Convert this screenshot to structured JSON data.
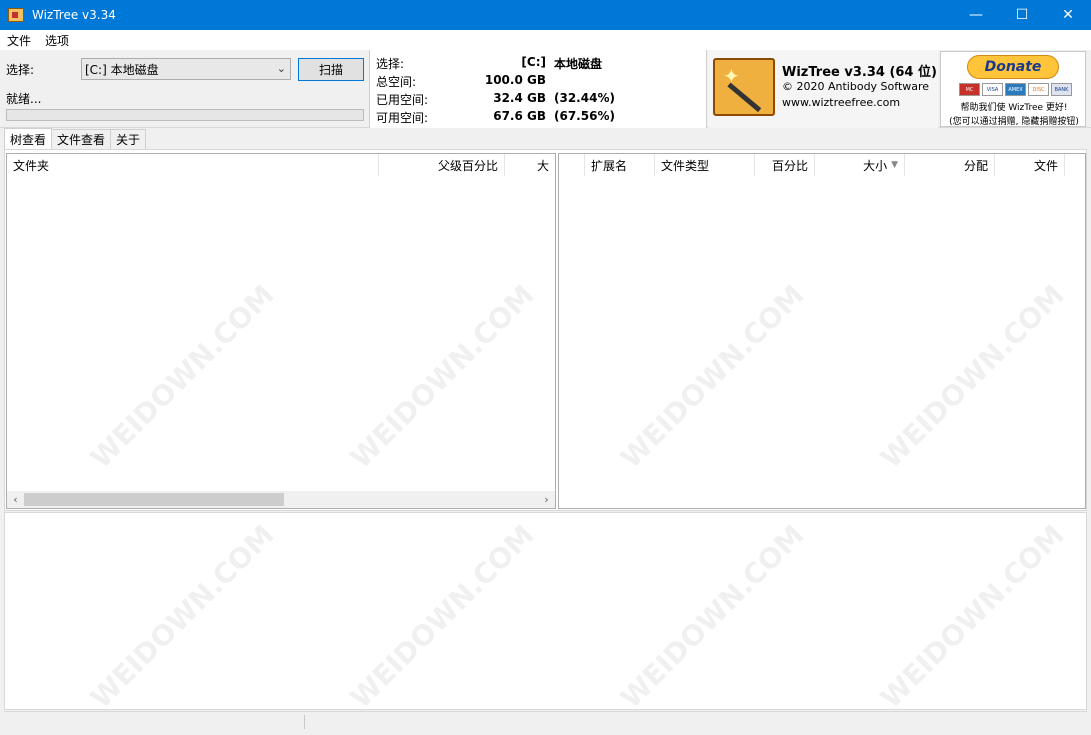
{
  "window": {
    "title": "WizTree v3.34",
    "controls": {
      "minimize": "—",
      "maximize": "☐",
      "close": "✕"
    }
  },
  "menu": [
    "文件",
    "选项"
  ],
  "scan": {
    "select_label": "选择:",
    "drive_value": "[C:] 本地磁盘",
    "scan_button": "扫描",
    "status": "就绪..."
  },
  "info": {
    "select_label": "选择:",
    "select_drive": "[C:]",
    "select_name": "本地磁盘",
    "total_label": "总空间:",
    "total_value": "100.0 GB",
    "used_label": "已用空间:",
    "used_value": "32.4 GB",
    "used_pct": "(32.44%)",
    "free_label": "可用空间:",
    "free_value": "67.6 GB",
    "free_pct": "(67.56%)"
  },
  "brand": {
    "name": "WizTree v3.34 (64 位)",
    "copyright": "© 2020 Antibody Software",
    "url": "www.wiztreefree.com"
  },
  "donate": {
    "button": "Donate",
    "cards": [
      "MC",
      "VISA",
      "AMEX",
      "DISC",
      "BANK"
    ],
    "help_text": "帮助我们使 WizTree 更好!",
    "note_text": "(您可以通过捐赠, 隐藏捐赠按钮)"
  },
  "tabs": [
    "树查看",
    "文件查看",
    "关于"
  ],
  "tree_view": {
    "columns": [
      "文件夹",
      "父级百分比",
      "大"
    ]
  },
  "file_types": {
    "columns": [
      "扩展名",
      "文件类型",
      "百分比",
      "大小",
      "分配",
      "文件"
    ]
  },
  "icons": {
    "scroll_left": "‹",
    "scroll_right": "›",
    "dropdown": "⌄",
    "sort_desc": "▼"
  },
  "watermark": "WEIDOWN.COM"
}
